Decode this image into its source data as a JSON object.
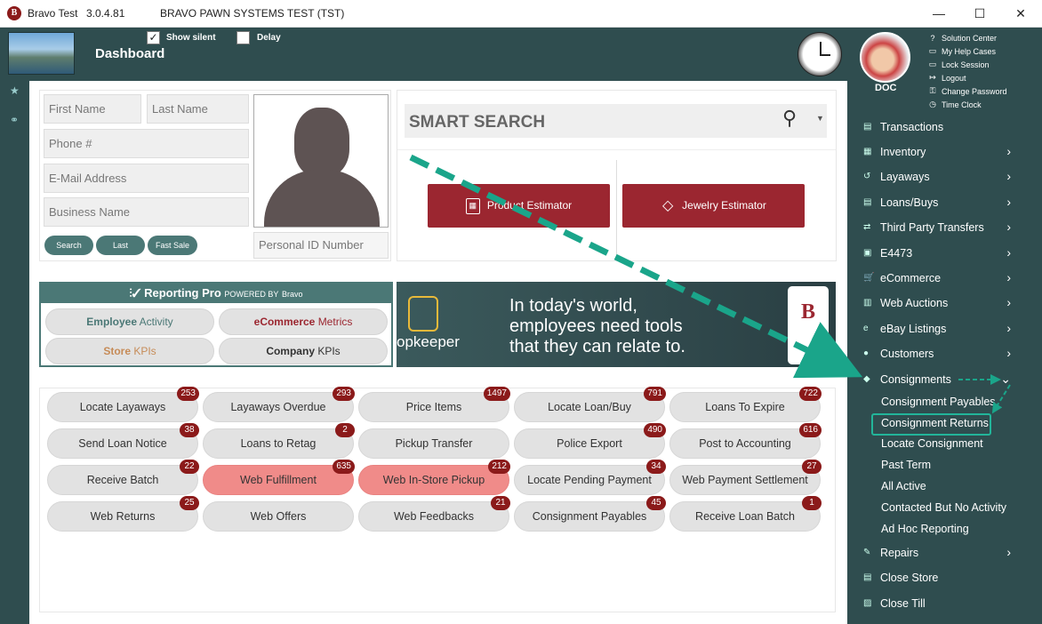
{
  "window": {
    "app_name": "Bravo Test",
    "version": "3.0.4.81",
    "system_name": "BRAVO PAWN SYSTEMS TEST (TST)",
    "app_icon_letter": "B",
    "minimize": "—",
    "maximize": "☐",
    "close": "✕"
  },
  "header": {
    "title": "Dashboard",
    "show_silent_label": "Show silent",
    "show_silent_checked": "✓",
    "delay_label": "Delay",
    "user_name": "DOC",
    "user_links": [
      {
        "icon": "?",
        "label": "Solution Center"
      },
      {
        "icon": "▭",
        "label": "My Help Cases"
      },
      {
        "icon": "▭",
        "label": "Lock Session"
      },
      {
        "icon": "↦",
        "label": "Logout"
      },
      {
        "icon": "⚿",
        "label": "Change Password"
      },
      {
        "icon": "◷",
        "label": "Time Clock"
      }
    ]
  },
  "search_form": {
    "first_name_placeholder": "First Name",
    "last_name_placeholder": "Last Name",
    "phone_placeholder": "Phone #",
    "email_placeholder": "E-Mail Address",
    "business_placeholder": "Business Name",
    "personal_id_placeholder": "Personal ID Number",
    "search_button": "Search",
    "last_button": "Last",
    "fast_sale_button": "Fast Sale"
  },
  "smart_search": {
    "placeholder": "SMART SEARCH",
    "product_estimator": "Product Estimator",
    "jewelry_estimator": "Jewelry Estimator"
  },
  "reporting": {
    "title": "Reporting Pro",
    "powered_by": "POWERED BY",
    "brand": "Bravo",
    "employee_a": "Employee",
    "employee_b": "Activity",
    "ecommerce_a": "eCommerce",
    "ecommerce_b": "Metrics",
    "store_a": "Store",
    "store_b": "KPIs",
    "company_a": "Company",
    "company_b": "KPIs"
  },
  "banner": {
    "line1": "In today's world,",
    "line2": "employees need tools",
    "line3": "that they can relate to.",
    "brand": "opkeeper",
    "phone_letter": "B"
  },
  "quick_buttons": [
    {
      "label": "Locate Layaways",
      "badge": "253",
      "highlight": false
    },
    {
      "label": "Layaways Overdue",
      "badge": "293",
      "highlight": false
    },
    {
      "label": "Price Items",
      "badge": "1497",
      "highlight": false
    },
    {
      "label": "Locate Loan/Buy",
      "badge": "791",
      "highlight": false
    },
    {
      "label": "Loans To Expire",
      "badge": "722",
      "highlight": false
    },
    {
      "label": "Send Loan Notice",
      "badge": "38",
      "highlight": false
    },
    {
      "label": "Loans to Retag",
      "badge": "2",
      "highlight": false
    },
    {
      "label": "Pickup Transfer",
      "badge": "",
      "highlight": false
    },
    {
      "label": "Police Export",
      "badge": "490",
      "highlight": false
    },
    {
      "label": "Post to Accounting",
      "badge": "616",
      "highlight": false
    },
    {
      "label": "Receive Batch",
      "badge": "22",
      "highlight": false
    },
    {
      "label": "Web Fulfillment",
      "badge": "635",
      "highlight": true
    },
    {
      "label": "Web In-Store Pickup",
      "badge": "212",
      "highlight": true
    },
    {
      "label": "Locate Pending Payment",
      "badge": "34",
      "highlight": false
    },
    {
      "label": "Web Payment Settlement",
      "badge": "27",
      "highlight": false
    },
    {
      "label": "Web Returns",
      "badge": "25",
      "highlight": false
    },
    {
      "label": "Web Offers",
      "badge": "",
      "highlight": false
    },
    {
      "label": "Web Feedbacks",
      "badge": "21",
      "highlight": false
    },
    {
      "label": "Consignment Payables",
      "badge": "45",
      "highlight": false
    },
    {
      "label": "Receive Loan Batch",
      "badge": "1",
      "highlight": false
    }
  ],
  "side_menu": [
    {
      "label": "Transactions",
      "icon": "▤",
      "chevron": ""
    },
    {
      "label": "Inventory",
      "icon": "▦",
      "chevron": "›"
    },
    {
      "label": "Layaways",
      "icon": "↺",
      "chevron": "›"
    },
    {
      "label": "Loans/Buys",
      "icon": "▤",
      "chevron": "›"
    },
    {
      "label": "Third Party Transfers",
      "icon": "⇄",
      "chevron": "›"
    },
    {
      "label": "E4473",
      "icon": "▣",
      "chevron": "›"
    },
    {
      "label": "eCommerce",
      "icon": "🛒",
      "chevron": "›"
    },
    {
      "label": "Web Auctions",
      "icon": "▥",
      "chevron": "›"
    },
    {
      "label": "eBay Listings",
      "icon": "e",
      "chevron": "›"
    },
    {
      "label": "Customers",
      "icon": "●",
      "chevron": "›"
    },
    {
      "label": "Consignments",
      "icon": "◆",
      "chevron": "⌄"
    }
  ],
  "consignment_sub": [
    "Consignment Payables",
    "Consignment Returns",
    "Locate Consignment",
    "Past Term",
    "All Active",
    "Contacted But No Activity",
    "Ad Hoc Reporting"
  ],
  "side_menu_bottom": [
    {
      "label": "Repairs",
      "icon": "✎",
      "chevron": "›"
    },
    {
      "label": "Close Store",
      "icon": "▤",
      "chevron": ""
    },
    {
      "label": "Close Till",
      "icon": "▨",
      "chevron": ""
    }
  ],
  "colors": {
    "frame": "#2f4d4f",
    "accent_red": "#9b2630",
    "teal_button": "#4b7876",
    "highlight": "#f08b89",
    "annotation_green": "#22b59a"
  }
}
